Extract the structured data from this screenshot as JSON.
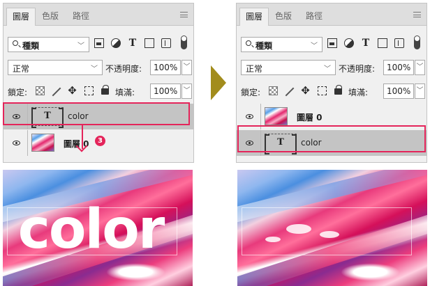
{
  "tabs": [
    "圖層",
    "色版",
    "路徑"
  ],
  "filter": {
    "label": "種類"
  },
  "blend": {
    "mode": "正常",
    "opacity_label": "不透明度:",
    "opacity_value": "100%"
  },
  "lock": {
    "label": "鎖定:",
    "fill_label": "填滿:",
    "fill_value": "100%"
  },
  "left_panel": {
    "layers": [
      {
        "name": "color",
        "type": "text",
        "selected": true
      },
      {
        "name": "圖層 0",
        "type": "image",
        "selected": false
      }
    ]
  },
  "right_panel": {
    "layers": [
      {
        "name": "圖層 0",
        "type": "image",
        "selected": false
      },
      {
        "name": "color",
        "type": "text",
        "selected": true
      }
    ]
  },
  "step_badge": "3",
  "canvas_text": "color",
  "colors": {
    "highlight": "#e4245a",
    "arrow": "#a28c1c",
    "selected_row": "#c4c4c4"
  },
  "icons": [
    "search-icon",
    "image-filter-icon",
    "adjustment-filter-icon",
    "type-filter-icon",
    "shape-filter-icon",
    "smart-object-filter-icon",
    "filter-toggle-icon",
    "menu-icon",
    "lock-transparent-icon",
    "lock-brush-icon",
    "lock-move-icon",
    "lock-artboard-icon",
    "lock-all-icon",
    "eye-icon"
  ]
}
